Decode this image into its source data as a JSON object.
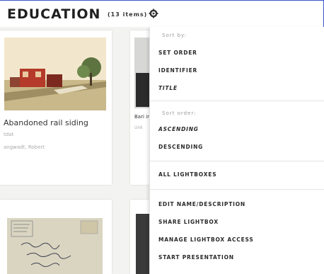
{
  "header": {
    "title": "EDUCATION",
    "count": "(13 items)"
  },
  "cards": [
    {
      "caption": "Abandoned rail siding",
      "meta1": "tdat",
      "meta2": "angwadt, Robert"
    },
    {
      "caption": "Bari inte",
      "meta": "Unk"
    }
  ],
  "menu": {
    "sort_by_label": "Sort by:",
    "sort_options": [
      "SET ORDER",
      "IDENTIFIER",
      "TITLE"
    ],
    "sort_order_label": "Sort order:",
    "order_options": [
      "ASCENDING",
      "DESCENDING"
    ],
    "all_lightboxes": "ALL LIGHTBOXES",
    "actions": [
      "EDIT NAME/DESCRIPTION",
      "SHARE LIGHTBOX",
      "MANAGE LIGHTBOX ACCESS",
      "START PRESENTATION"
    ]
  },
  "colors": {
    "header_border": "#3b55c9",
    "page_bg": "#f3f3f1"
  }
}
